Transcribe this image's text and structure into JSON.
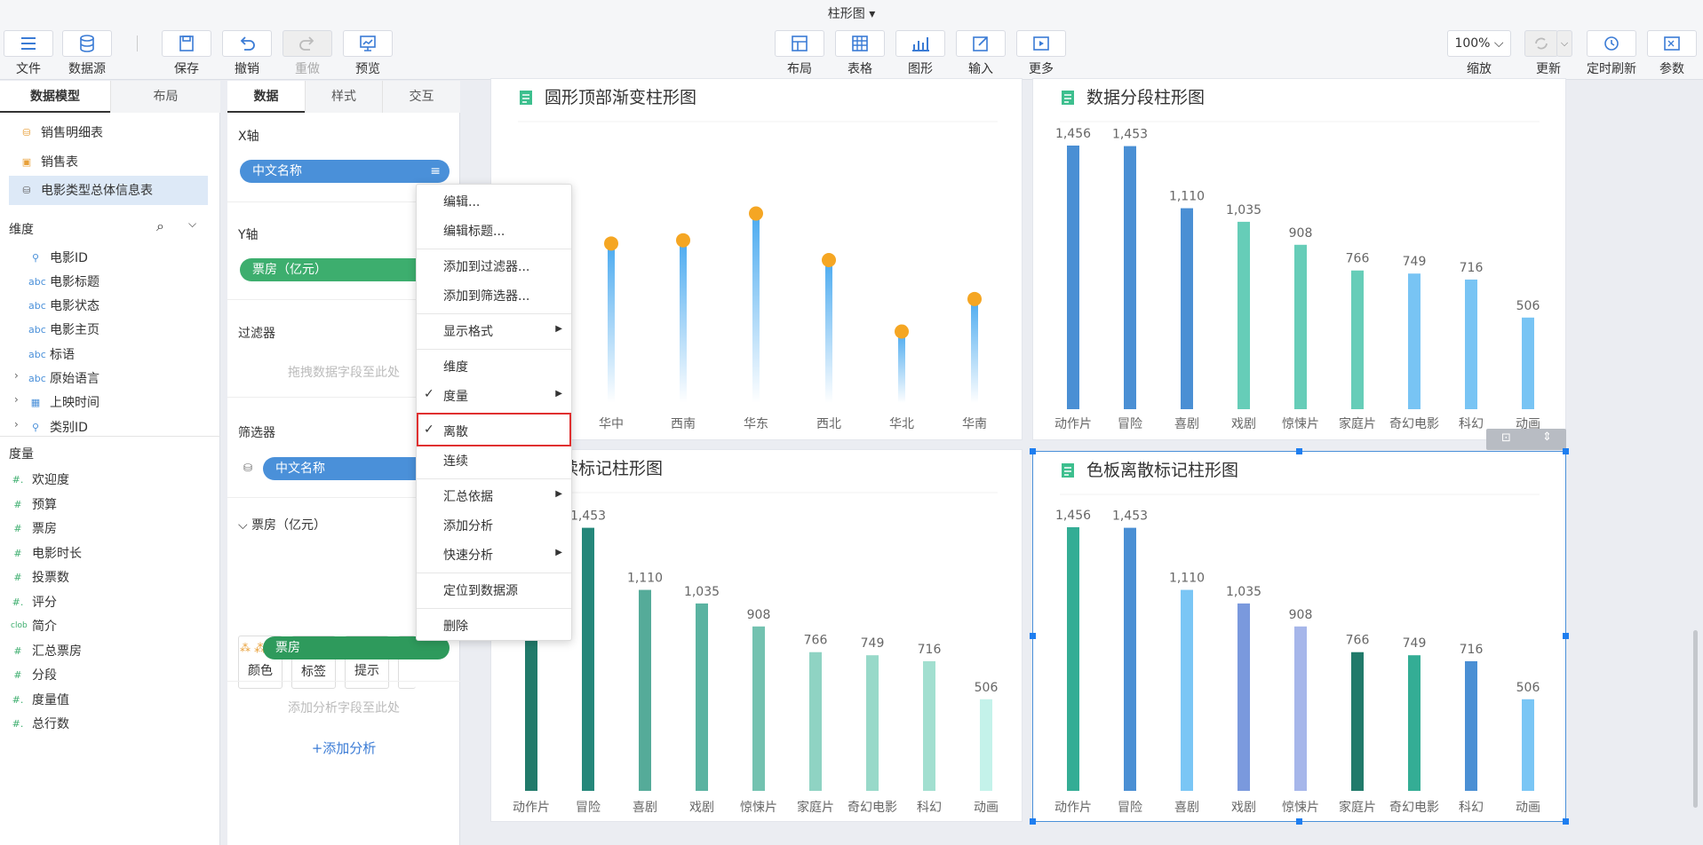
{
  "window": {
    "title": "柱形图"
  },
  "toolbar": {
    "file": "文件",
    "datasource": "数据源",
    "save": "保存",
    "undo": "撤销",
    "redo": "重做",
    "preview": "预览",
    "layout": "布局",
    "table": "表格",
    "chart": "图形",
    "input": "输入",
    "more": "更多",
    "zoom_value": "100%",
    "zoom": "缩放",
    "refresh": "更新",
    "timed_refresh": "定时刷新",
    "params": "参数"
  },
  "left_panel": {
    "tabs": [
      "数据模型",
      "布局"
    ],
    "tables": [
      "销售明细表",
      "销售表",
      "电影类型总体信息表"
    ],
    "dimension_title": "维度",
    "dimensions": [
      {
        "icon": "key",
        "label": "电影ID"
      },
      {
        "icon": "abc",
        "label": "电影标题"
      },
      {
        "icon": "abc",
        "label": "电影状态"
      },
      {
        "icon": "abc",
        "label": "电影主页"
      },
      {
        "icon": "abc",
        "label": "标语"
      },
      {
        "icon": "abc",
        "label": "原始语言"
      },
      {
        "icon": "calendar",
        "label": "上映时间"
      },
      {
        "icon": "key",
        "label": "类别ID"
      }
    ],
    "measure_title": "度量",
    "measures": [
      {
        "icon": "#.",
        "label": "欢迎度"
      },
      {
        "icon": "#",
        "label": "预算"
      },
      {
        "icon": "#",
        "label": "票房"
      },
      {
        "icon": "#",
        "label": "电影时长"
      },
      {
        "icon": "#",
        "label": "投票数"
      },
      {
        "icon": "#.",
        "label": "评分"
      },
      {
        "icon": "clob",
        "label": "简介"
      },
      {
        "icon": "#",
        "label": "汇总票房"
      },
      {
        "icon": "#",
        "label": "分段"
      },
      {
        "icon": "#.",
        "label": "度量值"
      },
      {
        "icon": "#.",
        "label": "总行数"
      }
    ]
  },
  "mid_panel": {
    "tabs": [
      "数据",
      "样式",
      "交互"
    ],
    "x_axis": "X轴",
    "x_field": "中文名称",
    "y_axis": "Y轴",
    "y_field": "票房（亿元）",
    "filter": "过滤器",
    "filter_hint": "拖拽数据字段至此处",
    "selector": "筛选器",
    "selector_field": "中文名称",
    "measure_group": "票房（亿元）",
    "marks": [
      "颜色",
      "标签",
      "提示"
    ],
    "color_field": "票房",
    "analysis_hint": "添加分析字段至此处",
    "add_analysis": "添加分析"
  },
  "context_menu": {
    "items": [
      "编辑...",
      "编辑标题...",
      "添加到过滤器...",
      "添加到筛选器...",
      "显示格式",
      "维度",
      "度量",
      "离散",
      "连续",
      "汇总依据",
      "添加分析",
      "快速分析",
      "定位到数据源",
      "删除"
    ]
  },
  "colors": {
    "accent": "#4a90d9",
    "green_pill": "#3dae6e",
    "highlight": "#e03030"
  },
  "chart_data": [
    {
      "type": "bar",
      "title": "圆形顶部渐变柱形图",
      "categories": [
        "华中",
        "西南",
        "华东",
        "西北",
        "华北",
        "华南"
      ],
      "values": [
        1250,
        1275,
        1485,
        1120,
        560,
        815
      ],
      "ylim": [
        0,
        1600
      ],
      "data_labels": false
    },
    {
      "type": "bar",
      "title": "数据分段柱形图",
      "categories": [
        "动作片",
        "冒险",
        "喜剧",
        "戏剧",
        "惊悚片",
        "家庭片",
        "奇幻电影",
        "科幻",
        "动画"
      ],
      "values": [
        1456,
        1453,
        1110,
        1035,
        908,
        766,
        749,
        716,
        506
      ],
      "value_labels": [
        "1,456",
        "1,453",
        "1,110",
        "1,035",
        "908",
        "766",
        "749",
        "716",
        "506"
      ],
      "colors": [
        "#4a8fd4",
        "#4a8fd4",
        "#4a8fd4",
        "#66cdb8",
        "#66cdb8",
        "#66cdb8",
        "#78c4f4",
        "#78c4f4",
        "#78c4f4"
      ]
    },
    {
      "type": "bar",
      "title": "连续标记柱形图",
      "categories": [
        "动作片",
        "冒险",
        "喜剧",
        "戏剧",
        "惊悚片",
        "家庭片",
        "奇幻电影",
        "科幻",
        "动画"
      ],
      "values": [
        1456,
        1453,
        1110,
        1035,
        908,
        766,
        749,
        716,
        506
      ],
      "value_labels": [
        "1,456",
        "1,453",
        "1,110",
        "1,035",
        "908",
        "766",
        "749",
        "716",
        "506"
      ],
      "colors": [
        "#217a6a",
        "#25877a",
        "#55ab99",
        "#5ab3a1",
        "#73c2b0",
        "#8fd3c3",
        "#98d9c9",
        "#a2dfd0",
        "#c4f2ea"
      ]
    },
    {
      "type": "bar",
      "title": "色板离散标记柱形图",
      "categories": [
        "动作片",
        "冒险",
        "喜剧",
        "戏剧",
        "惊悚片",
        "家庭片",
        "奇幻电影",
        "科幻",
        "动画"
      ],
      "values": [
        1456,
        1453,
        1110,
        1035,
        908,
        766,
        749,
        716,
        506
      ],
      "value_labels": [
        "1,456",
        "1,453",
        "1,110",
        "1,035",
        "908",
        "766",
        "749",
        "716",
        "506"
      ],
      "colors": [
        "#34ad95",
        "#4a8fd4",
        "#7ac6f5",
        "#7a99dd",
        "#a6b6ea",
        "#217a6a",
        "#34ad95",
        "#4a8fd4",
        "#7ac6f5"
      ]
    }
  ]
}
